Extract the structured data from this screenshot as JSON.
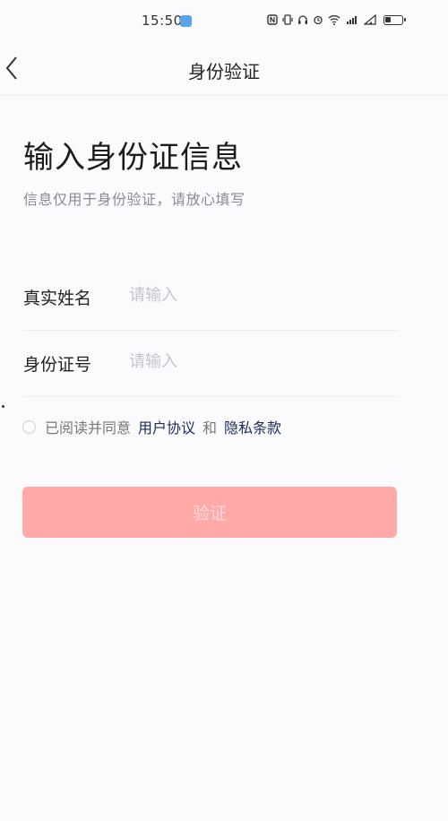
{
  "status_bar": {
    "time": "15:50",
    "icons": [
      "nfc-icon",
      "vibrate-icon",
      "headphones-icon",
      "alarm-icon",
      "wifi-icon",
      "signal-icon",
      "signal-icon",
      "battery-icon"
    ]
  },
  "nav": {
    "title": "身份验证"
  },
  "heading": "输入身份证信息",
  "subheading": "信息仅用于身份验证，请放心填写",
  "form": {
    "name": {
      "label": "真实姓名",
      "placeholder": "请输入",
      "value": ""
    },
    "id_number": {
      "label": "身份证号",
      "placeholder": "请输入",
      "value": ""
    }
  },
  "agreement": {
    "prefix": "已阅读并同意",
    "user_agreement": "用户协议",
    "and": "和",
    "privacy_policy": "隐私条款",
    "checked": false
  },
  "submit_button": {
    "label": "验证"
  },
  "colors": {
    "accent_disabled": "#ffa9a9",
    "link": "#1e2a5a",
    "background": "#fbfbfd"
  }
}
